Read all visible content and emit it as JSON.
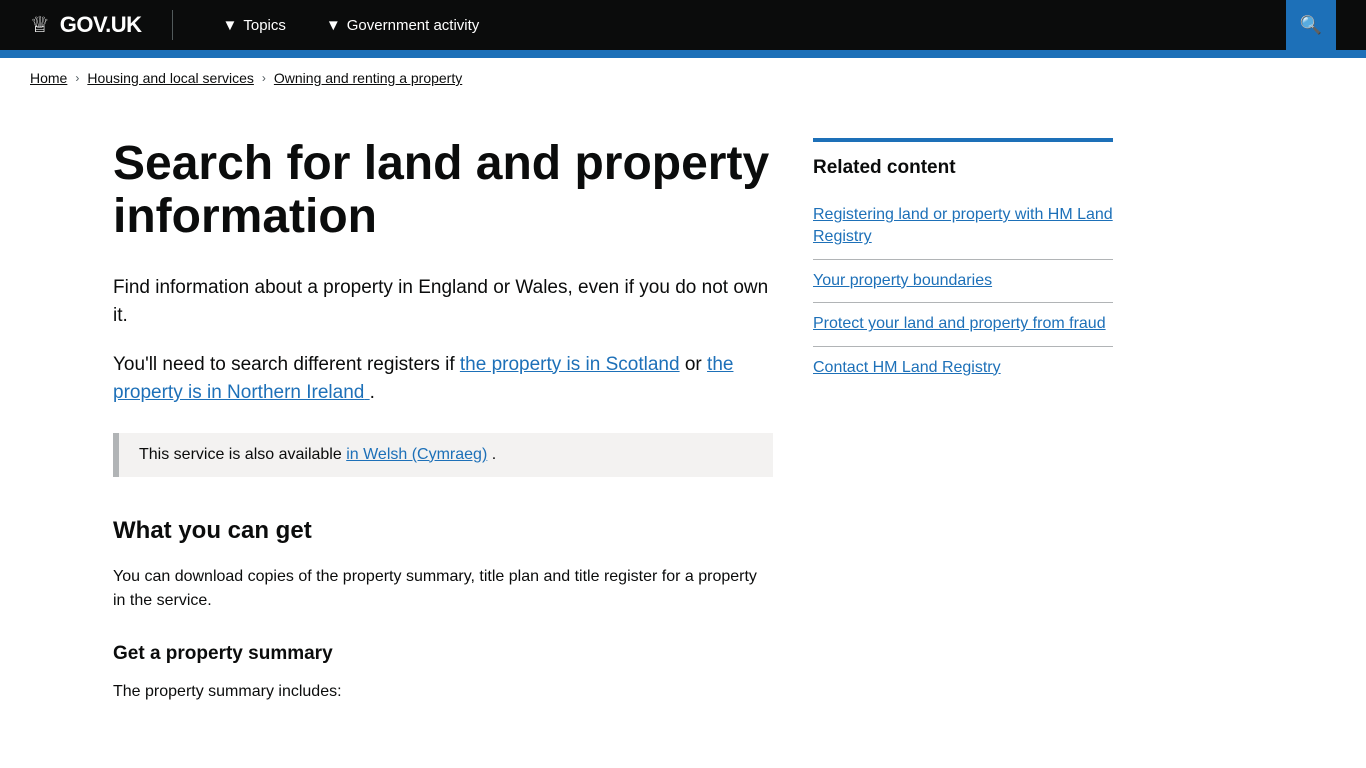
{
  "header": {
    "logo_text": "GOV.UK",
    "nav": {
      "topics_label": "Topics",
      "government_activity_label": "Government activity"
    },
    "search_icon": "🔍"
  },
  "breadcrumb": {
    "items": [
      {
        "label": "Home",
        "href": "#"
      },
      {
        "label": "Housing and local services",
        "href": "#"
      },
      {
        "label": "Owning and renting a property",
        "href": "#"
      }
    ]
  },
  "main": {
    "page_title": "Search for land and property information",
    "intro_paragraph": "Find information about a property in England or Wales, even if you do not own it.",
    "registers_text_before": "You'll need to search different registers if ",
    "scotland_link_text": "the property is in Scotland",
    "registers_text_middle": " or ",
    "northern_ireland_link_text": "the property is in Northern Ireland",
    "registers_text_after": ".",
    "welsh_note_before": "This service is also available ",
    "welsh_link_text": "in Welsh (Cymraeg)",
    "welsh_note_after": ".",
    "what_you_can_get_heading": "What you can get",
    "what_you_can_get_text": "You can download copies of the property summary, title plan and title register for a property in the service.",
    "property_summary_heading": "Get a property summary",
    "property_summary_text": "The property summary includes:"
  },
  "sidebar": {
    "related_heading": "Related content",
    "links": [
      {
        "text": "Registering land or property with HM Land Registry",
        "href": "#"
      },
      {
        "text": "Your property boundaries",
        "href": "#"
      },
      {
        "text": "Protect your land and property from fraud",
        "href": "#"
      },
      {
        "text": "Contact HM Land Registry",
        "href": "#"
      }
    ]
  }
}
